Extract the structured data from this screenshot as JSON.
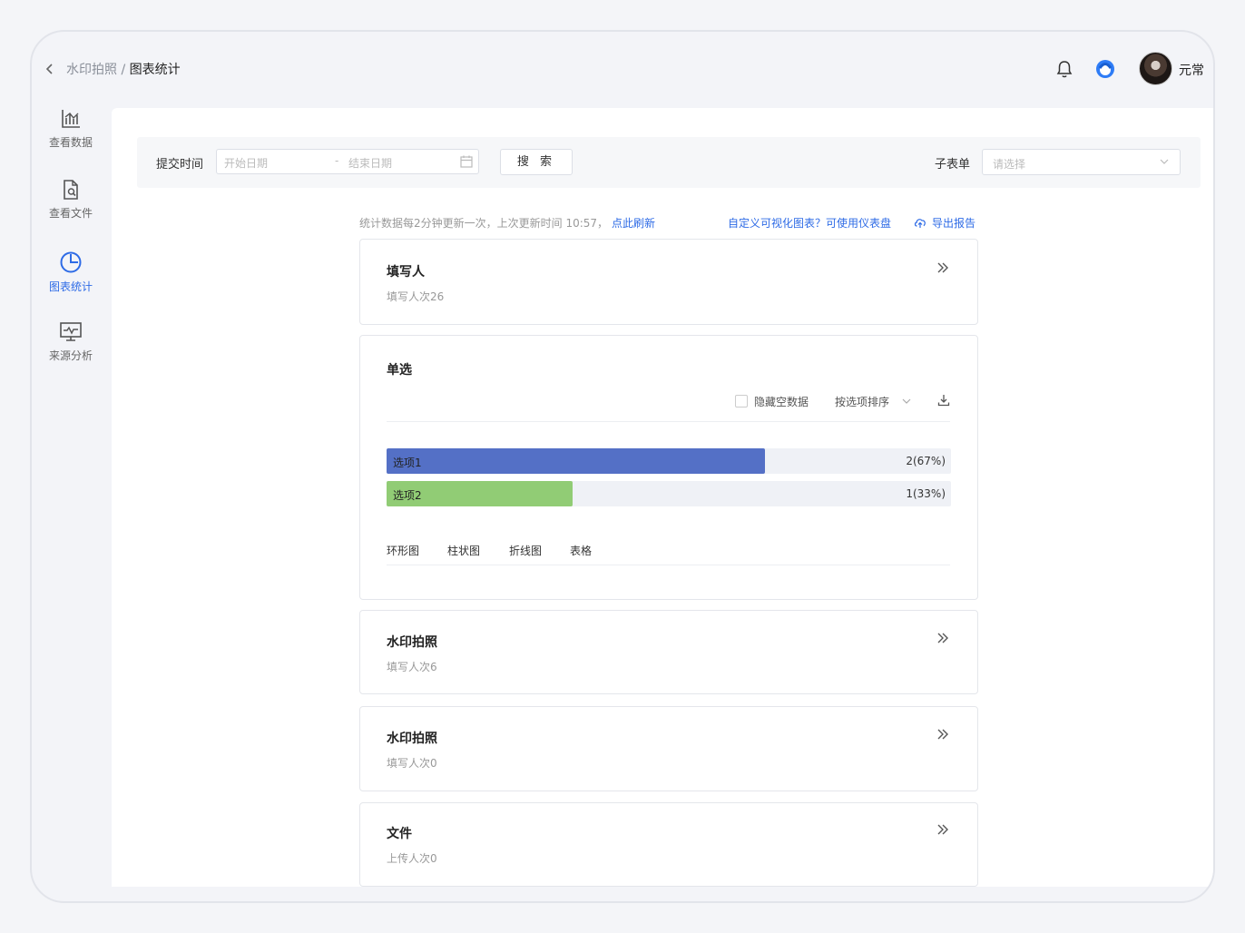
{
  "breadcrumb": {
    "parent": "水印拍照",
    "separator": " / ",
    "current": "图表统计"
  },
  "user": {
    "name": "元常"
  },
  "sidebar": {
    "items": [
      {
        "label": "查看数据",
        "icon": "chart-icon",
        "active": false
      },
      {
        "label": "查看文件",
        "icon": "file-search-icon",
        "active": false
      },
      {
        "label": "图表统计",
        "icon": "pie-chart-icon",
        "active": true
      },
      {
        "label": "来源分析",
        "icon": "monitor-icon",
        "active": false
      }
    ]
  },
  "filter": {
    "submit_time_label": "提交时间",
    "start_placeholder": "开始日期",
    "range_separator": "-",
    "end_placeholder": "结束日期",
    "search_label": "搜 索",
    "subform_label": "子表单",
    "subform_placeholder": "请选择"
  },
  "info": {
    "text": "统计数据每2分钟更新一次，上次更新时间 10:57，",
    "refresh_link": "点此刷新",
    "dashboard_link": "自定义可视化图表？可使用仪表盘",
    "export_label": "导出报告"
  },
  "cards": [
    {
      "title": "填写人",
      "sub": "填写人次26"
    },
    {
      "title": "水印拍照",
      "sub": "填写人次6"
    },
    {
      "title": "水印拍照",
      "sub": "填写人次0"
    },
    {
      "title": "文件",
      "sub": "上传人次0"
    }
  ],
  "single_choice": {
    "title": "单选",
    "hide_empty_label": "隐藏空数据",
    "sort_label": "按选项排序",
    "tabs": [
      "环形图",
      "柱状图",
      "折线图",
      "表格"
    ]
  },
  "chart_data": {
    "type": "bar",
    "categories": [
      "选项1",
      "选项2"
    ],
    "values": [
      2,
      1
    ],
    "labels": [
      "2(67%)",
      "1(33%)"
    ],
    "fractions": [
      0.67,
      0.33
    ],
    "colors": [
      "#5470c6",
      "#91cc75"
    ]
  }
}
